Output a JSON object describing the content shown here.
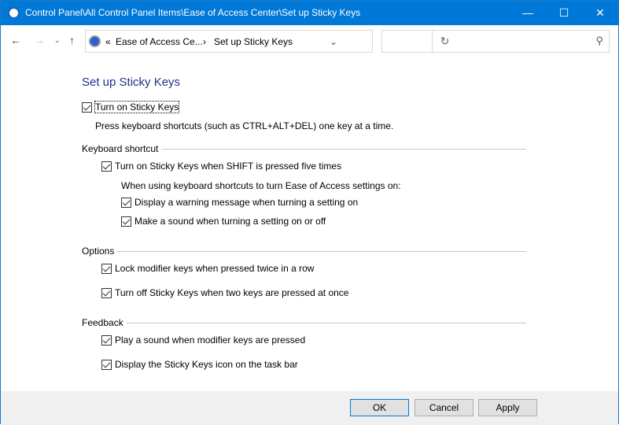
{
  "window": {
    "title": "Control Panel\\All Control Panel Items\\Ease of Access Center\\Set up Sticky Keys"
  },
  "nav": {
    "breadcrumb_overflow": "«",
    "breadcrumb": [
      "Ease of Access Ce...",
      "Set up Sticky Keys"
    ],
    "separator": "›",
    "search_placeholder": ""
  },
  "page": {
    "title": "Set up Sticky Keys",
    "main_checkbox": {
      "label": "Turn on Sticky Keys",
      "checked": true
    },
    "description": "Press keyboard shortcuts (such as CTRL+ALT+DEL) one key at a time.",
    "keyboard_shortcut": {
      "heading": "Keyboard shortcut",
      "shift": {
        "label": "Turn on Sticky Keys when SHIFT is pressed five times",
        "checked": true
      },
      "subtext": "When using keyboard shortcuts to turn Ease of Access settings on:",
      "warning": {
        "label": "Display a warning message when turning a setting on",
        "checked": true
      },
      "sound": {
        "label": "Make a sound when turning a setting on or off",
        "checked": true
      }
    },
    "options": {
      "heading": "Options",
      "lock": {
        "label": "Lock modifier keys when pressed twice in a row",
        "checked": true
      },
      "turnoff": {
        "label": "Turn off Sticky Keys when two keys are pressed at once",
        "checked": true
      }
    },
    "feedback": {
      "heading": "Feedback",
      "play": {
        "label": "Play a sound when modifier keys are pressed",
        "checked": true
      },
      "icon": {
        "label": "Display the Sticky Keys icon on the task bar",
        "checked": true
      }
    }
  },
  "buttons": {
    "ok": "OK",
    "cancel": "Cancel",
    "apply": "Apply"
  }
}
